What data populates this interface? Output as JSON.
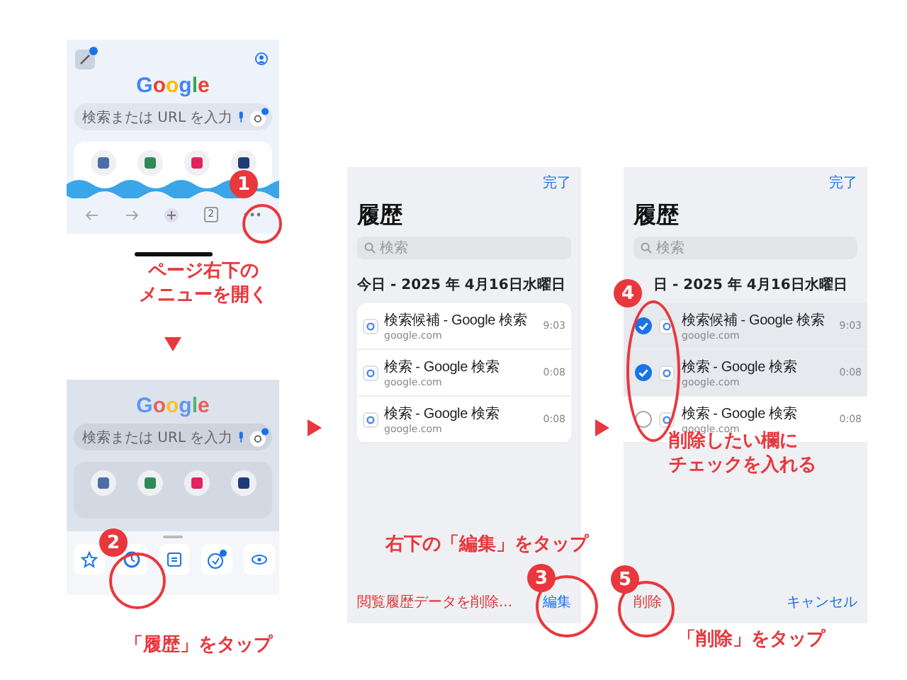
{
  "home_screen": {
    "logo": "Google",
    "search_placeholder": "検索または URL を入力",
    "tab_count": "2"
  },
  "menu_screen": {
    "logo": "Google",
    "search_placeholder": "検索または URL を入力"
  },
  "history_screen": {
    "done": "完了",
    "title": "履歴",
    "search_placeholder": "検索",
    "date": "今日 - 2025 年 4月16日水曜日",
    "entries": [
      {
        "title": "検索候補 - Google 検索",
        "url": "google.com",
        "time": "9:03"
      },
      {
        "title": "検索 - Google 検索",
        "url": "google.com",
        "time": "0:08"
      },
      {
        "title": "検索 - Google 検索",
        "url": "google.com",
        "time": "0:08"
      }
    ],
    "clear_link": "閲覧履歴データを削除...",
    "edit_button": "編集"
  },
  "edit_screen": {
    "done": "完了",
    "title": "履歴",
    "search_placeholder": "検索",
    "date": "日 - 2025 年 4月16日水曜日",
    "entries": [
      {
        "title": "検索候補 - Google 検索",
        "url": "google.com",
        "time": "9:03",
        "checked": true
      },
      {
        "title": "検索 - Google 検索",
        "url": "google.com",
        "time": "0:08",
        "checked": true
      },
      {
        "title": "検索 - Google 検索",
        "url": "google.com",
        "time": "0:08",
        "checked": false
      }
    ],
    "delete_button": "削除",
    "cancel_button": "キャンセル"
  },
  "steps": [
    {
      "number": "1",
      "caption": [
        "ページ右下の",
        "メニューを開く"
      ]
    },
    {
      "number": "2",
      "caption": [
        "「履歴」をタップ"
      ]
    },
    {
      "number": "3",
      "caption": [
        "右下の「編集」をタップ"
      ]
    },
    {
      "number": "4",
      "caption": [
        "削除したい欄に",
        "チェックを入れる"
      ]
    },
    {
      "number": "5",
      "caption": [
        "「削除」をタップ"
      ]
    }
  ]
}
